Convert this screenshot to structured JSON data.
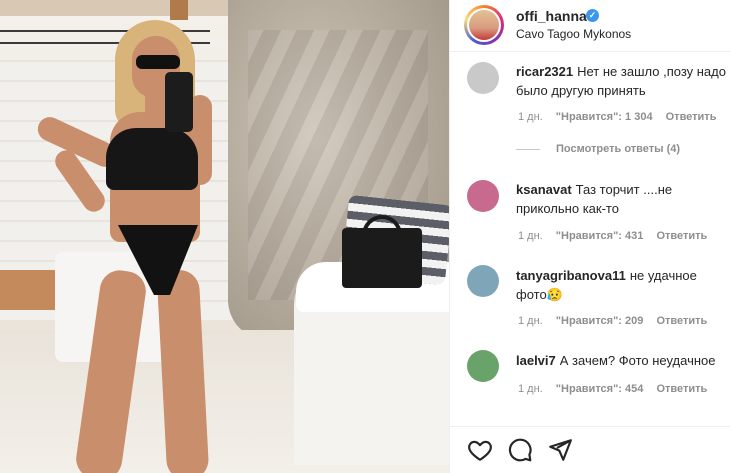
{
  "post": {
    "username": "offi_hanna",
    "location": "Cavo Tagoo Mykonos"
  },
  "comments": [
    {
      "user": "ricar2321",
      "text": "Нет не зашло ,позу надо было другую принять",
      "time": "1 дн.",
      "likes": "\"Нравится\": 1 304",
      "reply": "Ответить",
      "avatar_color": "#c9c9c9"
    },
    {
      "user": "ksanavat",
      "text": "Таз торчит ....не прикольно как-то",
      "time": "1 дн.",
      "likes": "\"Нравится\": 431",
      "reply": "Ответить",
      "avatar_color": "#c86a8e"
    },
    {
      "user": "tanyagribanova11",
      "text": "не удачное фото😥",
      "time": "1 дн.",
      "likes": "\"Нравится\": 209",
      "reply": "Ответить",
      "avatar_color": "#7fa6b8"
    },
    {
      "user": "laelvi7",
      "text": "А зачем? Фото неудачное",
      "time": "1 дн.",
      "likes": "\"Нравится\": 454",
      "reply": "Ответить",
      "avatar_color": "#6aa36a"
    }
  ],
  "view_replies": "Посмотреть ответы (4)",
  "colors": {
    "meta": "#8e8e8e",
    "text": "#262626",
    "verified": "#3897f0"
  },
  "icons": {
    "like": "heart-icon",
    "comment": "comment-icon",
    "share": "send-icon"
  }
}
